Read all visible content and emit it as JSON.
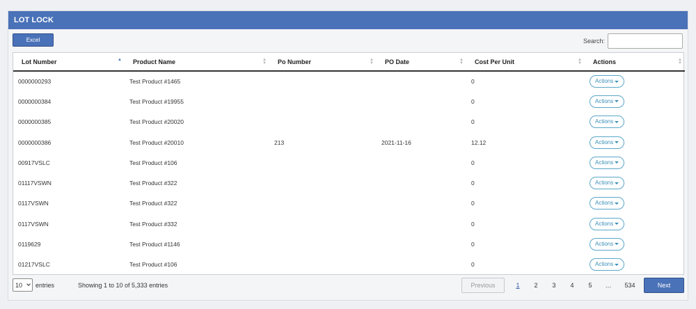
{
  "panel": {
    "title": "LOT LOCK"
  },
  "toolbar": {
    "excel_label": "Excel",
    "search_label": "Search:",
    "search_value": ""
  },
  "table": {
    "columns": [
      "Lot Number",
      "Product Name",
      "Po Number",
      "PO Date",
      "Cost Per Unit",
      "Actions"
    ],
    "sorted_column": "Lot Number",
    "sort_direction": "asc",
    "rows": [
      {
        "lot": "0000000293",
        "product": "Test Product #1465",
        "po": "",
        "date": "",
        "cost": "0",
        "action": "Actions"
      },
      {
        "lot": "0000000384",
        "product": "Test Product #19955",
        "po": "",
        "date": "",
        "cost": "0",
        "action": "Actions"
      },
      {
        "lot": "0000000385",
        "product": "Test Product #20020",
        "po": "",
        "date": "",
        "cost": "0",
        "action": "Actions"
      },
      {
        "lot": "0000000386",
        "product": "Test Product #20010",
        "po": "213",
        "date": "2021-11-16",
        "cost": "12.12",
        "action": "Actions"
      },
      {
        "lot": "00917VSLC",
        "product": "Test Product #106",
        "po": "",
        "date": "",
        "cost": "0",
        "action": "Actions"
      },
      {
        "lot": "01117VSWN",
        "product": "Test Product #322",
        "po": "",
        "date": "",
        "cost": "0",
        "action": "Actions"
      },
      {
        "lot": "0117VSWN",
        "product": "Test Product #322",
        "po": "",
        "date": "",
        "cost": "0",
        "action": "Actions"
      },
      {
        "lot": "0117VSWN",
        "product": "Test Product #332",
        "po": "",
        "date": "",
        "cost": "0",
        "action": "Actions"
      },
      {
        "lot": "0119629",
        "product": "Test Product #1146",
        "po": "",
        "date": "",
        "cost": "0",
        "action": "Actions"
      },
      {
        "lot": "01217VSLC",
        "product": "Test Product #106",
        "po": "",
        "date": "",
        "cost": "0",
        "action": "Actions"
      }
    ]
  },
  "footer": {
    "page_length": "10",
    "entries_label": "entries",
    "info": "Showing 1 to 10 of 5,333 entries",
    "pagination": {
      "previous": "Previous",
      "pages": [
        "1",
        "2",
        "3",
        "4",
        "5"
      ],
      "current": "1",
      "ellipsis": "…",
      "last": "534",
      "next": "Next"
    }
  },
  "colors": {
    "header_bg": "#4a72b8",
    "actions_border": "#5aa6c8",
    "background": "#eef0f4"
  }
}
